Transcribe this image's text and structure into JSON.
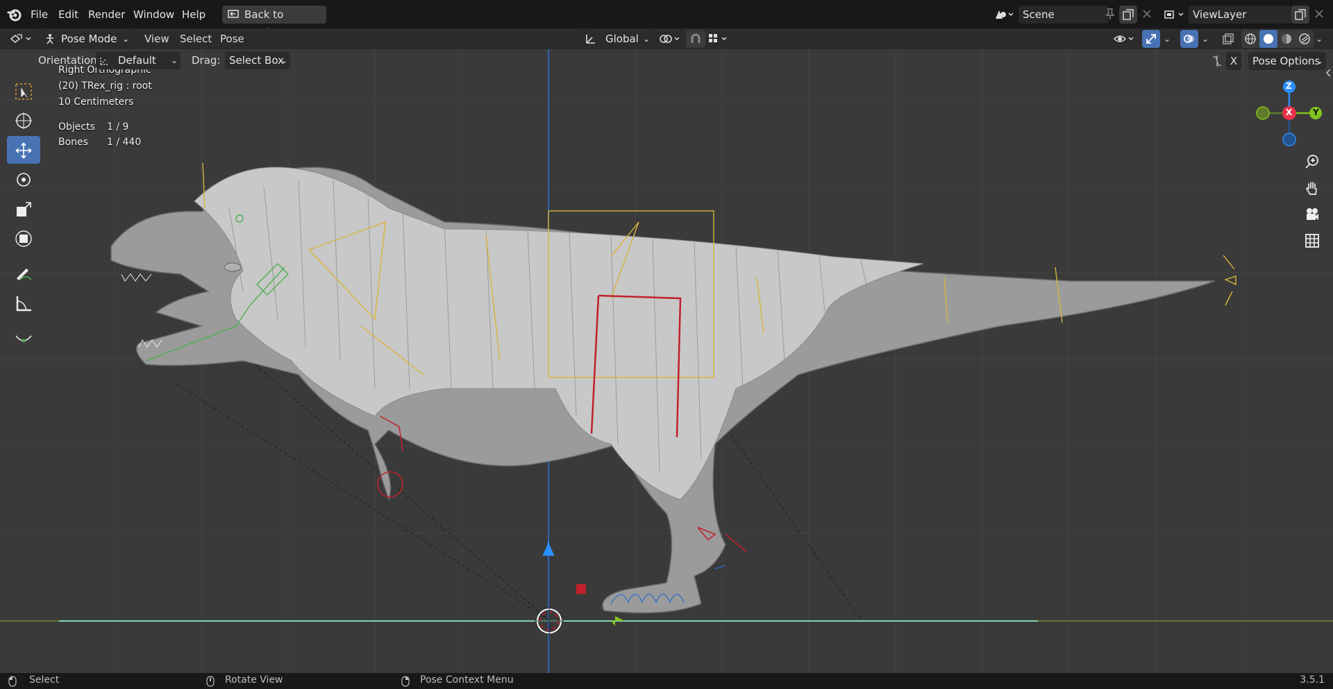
{
  "topbar": {
    "menus": [
      "File",
      "Edit",
      "Render",
      "Window",
      "Help"
    ],
    "back_button": "Back to Previous",
    "scene": "Scene",
    "view_layer": "ViewLayer"
  },
  "header": {
    "mode": "Pose Mode",
    "menus": [
      "View",
      "Select",
      "Pose"
    ],
    "transform_orientation": "Global"
  },
  "tool_settings": {
    "orientation_label": "Orientation:",
    "orientation_value": "Default",
    "drag_label": "Drag:",
    "drag_value": "Select Box",
    "x_toggle": "X",
    "pose_options": "Pose Options"
  },
  "viewport_info": {
    "view_name": "Right Orthographic",
    "object_info": "(20) TRex_rig : root",
    "scale": "10 Centimeters",
    "objects_label": "Objects",
    "objects_value": "1 / 9",
    "bones_label": "Bones",
    "bones_value": "1 / 440"
  },
  "gizmo": {
    "z": "Z",
    "x": "X",
    "y": "Y"
  },
  "status": {
    "select": "Select",
    "rotate": "Rotate View",
    "context": "Pose Context Menu",
    "version": "3.5.1"
  },
  "colors": {
    "accent": "#4772b3",
    "axis_x": "#e8334a",
    "axis_y": "#84c41e",
    "axis_z": "#2c8fff",
    "bone_outline": "#d8b53a"
  },
  "icons": [
    "blender-logo-icon",
    "back-icon",
    "scene-icon",
    "pin-icon",
    "new-icon",
    "close-icon",
    "view-layer-icon",
    "editor-type-icon",
    "pose-mode-icon",
    "orientation-icon",
    "snap-icon",
    "proportional-icon",
    "visibility-icon",
    "gizmo-icon",
    "overlay-icon",
    "xray-icon",
    "shading-wireframe-icon",
    "shading-solid-icon",
    "shading-material-icon",
    "shading-rendered-icon",
    "select-box-tool-icon",
    "cursor-tool-icon",
    "move-tool-icon",
    "rotate-tool-icon",
    "scale-tool-icon",
    "transform-tool-icon",
    "annotate-tool-icon",
    "measure-tool-icon",
    "relax-tool-icon",
    "zoom-icon",
    "pan-hand-icon",
    "camera-icon",
    "grid-icon",
    "mouse-left-icon",
    "mouse-middle-icon",
    "mouse-right-icon"
  ]
}
